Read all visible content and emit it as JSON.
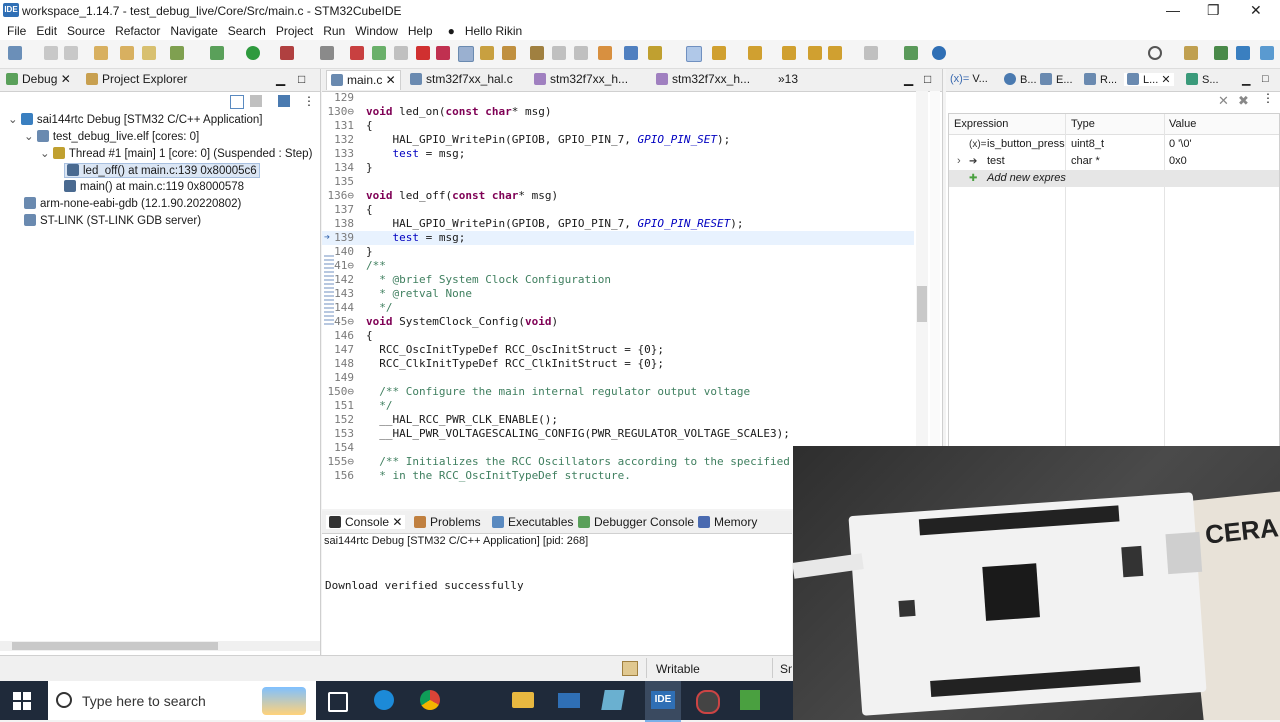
{
  "window": {
    "title": "workspace_1.14.7 - test_debug_live/Core/Src/main.c - STM32CubeIDE",
    "logo_text": "IDE",
    "minimize": "—",
    "maximize": "❐",
    "close": "✕"
  },
  "menu": [
    "File",
    "Edit",
    "Source",
    "Refactor",
    "Navigate",
    "Search",
    "Project",
    "Run",
    "Window",
    "Help"
  ],
  "user": "Hello Rikin",
  "left_panel": {
    "tabs": [
      "Debug",
      "Project Explorer"
    ],
    "tree": [
      {
        "label": "sai144rtc Debug [STM32 C/C++ Application]",
        "level": 0
      },
      {
        "label": "test_debug_live.elf [cores: 0]",
        "level": 1
      },
      {
        "label": "Thread #1 [main] 1 [core: 0] (Suspended : Step)",
        "level": 2
      },
      {
        "label": "led_off() at main.c:139 0x80005c6",
        "level": 3,
        "selected": true
      },
      {
        "label": "main() at main.c:119 0x8000578",
        "level": 3
      },
      {
        "label": "arm-none-eabi-gdb (12.1.90.20220802)",
        "level": 1
      },
      {
        "label": "ST-LINK (ST-LINK GDB server)",
        "level": 1
      }
    ]
  },
  "editor": {
    "tabs": [
      "main.c",
      "stm32f7xx_hal.c",
      "stm32f7xx_h...",
      "stm32f7xx_h..."
    ],
    "overflow_count": "»13",
    "lines": [
      {
        "n": "129",
        "t": ""
      },
      {
        "n": "130",
        "t": "void led_on(const char* msg)",
        "fold": true
      },
      {
        "n": "131",
        "t": "{"
      },
      {
        "n": "132",
        "t": "    HAL_GPIO_WritePin(GPIOB, GPIO_PIN_7, GPIO_PIN_SET);"
      },
      {
        "n": "133",
        "t": "    test = msg;"
      },
      {
        "n": "134",
        "t": "}"
      },
      {
        "n": "135",
        "t": ""
      },
      {
        "n": "136",
        "t": "void led_off(const char* msg)",
        "fold": true
      },
      {
        "n": "137",
        "t": "{"
      },
      {
        "n": "138",
        "t": "    HAL_GPIO_WritePin(GPIOB, GPIO_PIN_7, GPIO_PIN_RESET);"
      },
      {
        "n": "139",
        "t": "    test = msg;",
        "current": true
      },
      {
        "n": "140",
        "t": "}"
      },
      {
        "n": "141",
        "t": "/**",
        "fold": true
      },
      {
        "n": "142",
        "t": "  * @brief System Clock Configuration"
      },
      {
        "n": "143",
        "t": "  * @retval None"
      },
      {
        "n": "144",
        "t": "  */"
      },
      {
        "n": "145",
        "t": "void SystemClock_Config(void)",
        "fold": true
      },
      {
        "n": "146",
        "t": "{"
      },
      {
        "n": "147",
        "t": "  RCC_OscInitTypeDef RCC_OscInitStruct = {0};"
      },
      {
        "n": "148",
        "t": "  RCC_ClkInitTypeDef RCC_ClkInitStruct = {0};"
      },
      {
        "n": "149",
        "t": ""
      },
      {
        "n": "150",
        "t": "  /** Configure the main internal regulator output voltage",
        "fold": true
      },
      {
        "n": "151",
        "t": "  */"
      },
      {
        "n": "152",
        "t": "  __HAL_RCC_PWR_CLK_ENABLE();"
      },
      {
        "n": "153",
        "t": "  __HAL_PWR_VOLTAGESCALING_CONFIG(PWR_REGULATOR_VOLTAGE_SCALE3);"
      },
      {
        "n": "154",
        "t": ""
      },
      {
        "n": "155",
        "t": "  /** Initializes the RCC Oscillators according to the specified",
        "fold": true
      },
      {
        "n": "156",
        "t": "  * in the RCC_OscInitTypeDef structure."
      }
    ]
  },
  "right_panel": {
    "tabs": [
      "V...",
      "B...",
      "E...",
      "R...",
      "L...",
      "S..."
    ],
    "headers": [
      "Expression",
      "Type",
      "Value"
    ],
    "rows": [
      {
        "expr": "is_button_press",
        "type": "uint8_t",
        "value": "0 '\\0'",
        "prefix": "(x)="
      },
      {
        "expr": "test",
        "type": "char *",
        "value": "0x0",
        "prefix": "➔"
      },
      {
        "expr": "Add new expres",
        "type": "",
        "value": "",
        "prefix": "✚"
      }
    ]
  },
  "console": {
    "tabs": [
      "Console",
      "Problems",
      "Executables",
      "Debugger Console",
      "Memory"
    ],
    "header": "sai144rtc Debug [STM32 C/C++ Application]  [pid: 268]",
    "output": "Download verified successfully"
  },
  "status": {
    "mode": "Writable",
    "insert": "Sm"
  },
  "taskbar": {
    "search_placeholder": "Type here to search",
    "ide_label": "IDE"
  },
  "photo": {
    "board_text": "CERA"
  }
}
